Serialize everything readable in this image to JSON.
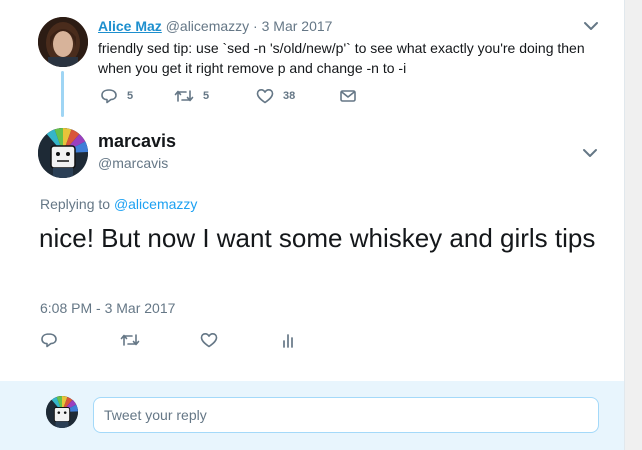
{
  "parent_tweet": {
    "author_name": "Alice Maz",
    "author_handle": "@alicemazzy",
    "separator": "·",
    "date": "3 Mar 2017",
    "text": "friendly sed tip: use `sed -n 's/old/new/p'` to see what exactly you're doing then when you get it right remove p and change -n to -i",
    "reply_count": "5",
    "retweet_count": "5",
    "like_count": "38",
    "icons": [
      "reply-icon",
      "retweet-icon",
      "like-icon",
      "direct-message-icon",
      "chevron-down-icon"
    ]
  },
  "main_tweet": {
    "author_name": "marcavis",
    "author_handle": "@marcavis",
    "replying_prefix": "Replying to",
    "replying_handle": "@alicemazzy",
    "text": "nice! But now I want some whiskey and girls tips",
    "timestamp": "6:08 PM - 3 Mar 2017",
    "icons": [
      "reply-icon",
      "retweet-icon",
      "like-icon",
      "analytics-icon",
      "chevron-down-icon"
    ]
  },
  "reply_composer": {
    "placeholder": "Tweet your reply"
  },
  "colors": {
    "link_blue": "#1da1f2",
    "name_blue": "#1d8fce",
    "muted_gray": "#657786",
    "thread_line": "#9fd5f4",
    "composer_bg": "#e8f5fd"
  }
}
